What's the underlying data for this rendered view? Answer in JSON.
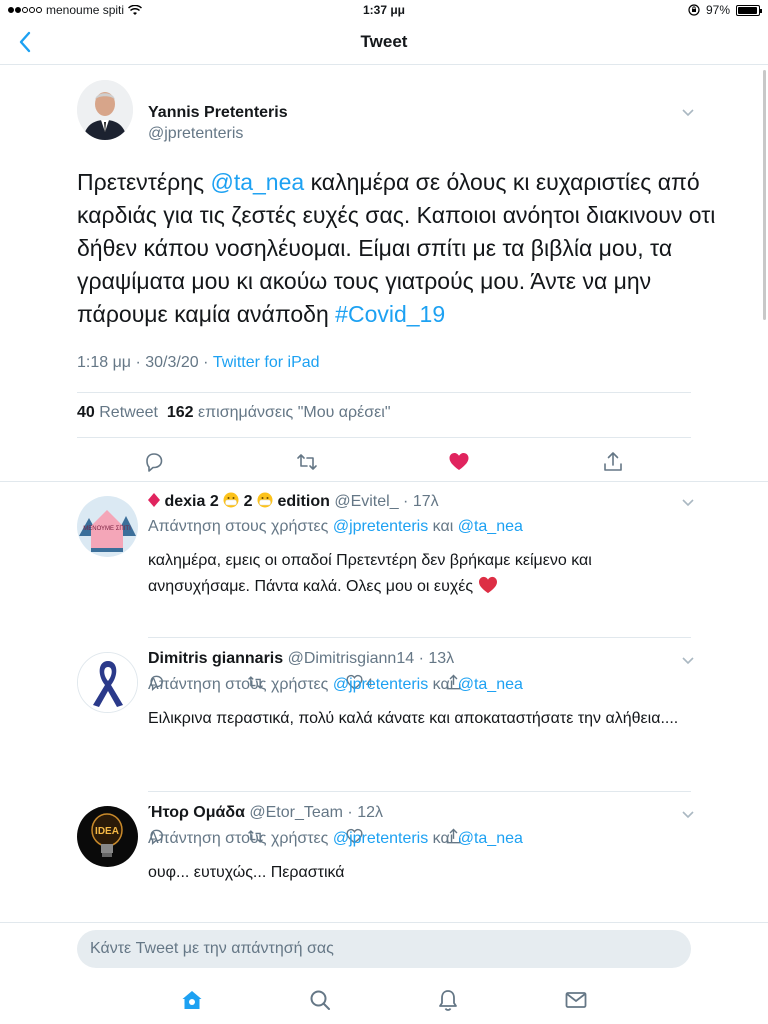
{
  "status_bar": {
    "carrier": "menoume spiti",
    "time": "1:37 μμ",
    "battery": "97%",
    "battery_level": 0.97
  },
  "nav": {
    "title": "Tweet"
  },
  "tweet": {
    "author_name": "Yannis Pretenteris",
    "author_handle": "@jpretenteris",
    "text_before": "Πρετεντέρης ",
    "mention": "@ta_nea",
    "text_middle": " καλημέρα σε όλους κι ευχαριστίες από καρδιάς για τις ζεστές ευχές σας. Καποιοι ανόητοι διακινουν οτι δήθεν κάπου νοσηλέυομαι. Είμαι σπίτι με τα βιβλία μου, τα γραψίματα μου κι ακούω τους γιατρούς μου. Άντε να μην πάρουμε καμία ανάποδη ",
    "hashtag": "#Covid_19",
    "timestamp": "1:18 μμ · 30/3/20 · ",
    "source": "Twitter for iPad",
    "retweets": "40",
    "retweets_label": "Retweet",
    "likes": "162",
    "likes_label": "επισημάνσεις \"Μου αρέσει\"",
    "liked": true
  },
  "replies": [
    {
      "name_prefix": "dexia 2",
      "name_mid": "2",
      "name_suffix": " edition",
      "handle": "@Evitel_",
      "time": " · 17λ",
      "to_prefix": "Απάντηση στους χρήστες ",
      "to_user1": "@jpretenteris",
      "to_and": " και ",
      "to_user2": "@ta_nea",
      "text": "καλημέρα, εμεις οι οπαδοί Πρετεντέρη δεν βρήκαμε κείμενο και ανησυχήσαμε. Πάντα καλά. Ολες μου οι ευχές",
      "likes": "4",
      "avatar_text": "ΜΕΝΟΥΜΕ ΣΠΙΤΙ"
    },
    {
      "name": "Dimitris giannaris",
      "handle": "@Dimitrisgiann14",
      "time": " · 13λ",
      "to_prefix": "Απάντηση στους χρήστες ",
      "to_user1": "@jpretenteris",
      "to_and": " και ",
      "to_user2": "@ta_nea",
      "text": "Ειλικρινα περαστικά, πολύ καλά κάνατε και αποκαταστήσατε την αλήθεια....",
      "likes": ""
    },
    {
      "name": "Ήτορ Ομάδα",
      "handle": "@Etor_Team",
      "time": " · 12λ",
      "to_prefix": "Απάντηση στους χρήστες ",
      "to_user1": "@jpretenteris",
      "to_and": " και ",
      "to_user2": "@ta_nea",
      "text": "ουφ... ευτυχώς... Περαστικά",
      "likes": "",
      "avatar_text": "IDEA"
    }
  ],
  "composer": {
    "placeholder": "Κάντε Tweet με την απάντησή σας"
  },
  "colors": {
    "accent": "#1da1f2",
    "like": "#e0245e",
    "muted": "#657786",
    "divider": "#e1e8ed"
  },
  "icons": {
    "tab_home": "home-icon",
    "tab_search": "search-icon",
    "tab_notifications": "bell-icon",
    "tab_messages": "mail-icon"
  }
}
